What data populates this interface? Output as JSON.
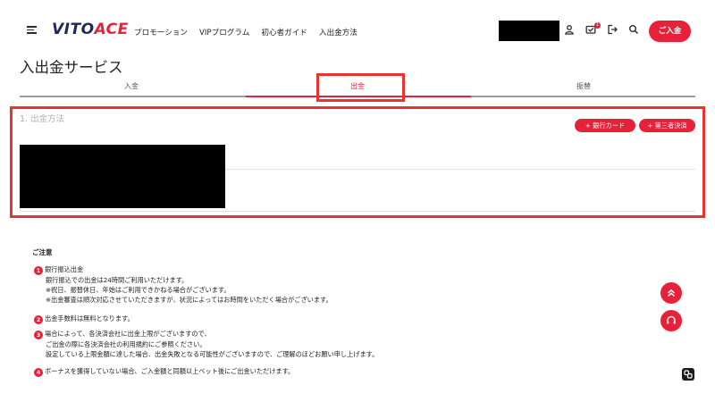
{
  "header": {
    "logo_main": "VITO",
    "logo_accent": "ACE",
    "nav": [
      "プロモーション",
      "VIPプログラム",
      "初心者ガイド",
      "入出金方法"
    ],
    "notification_count": "1",
    "deposit_button": "ご入金"
  },
  "page": {
    "title": "入出金サービス",
    "tabs": [
      "入金",
      "出金",
      "振替"
    ],
    "active_tab": "出金"
  },
  "withdraw": {
    "section_title": "1. 出金方法",
    "add_bank_card": "+ 銀行カード",
    "add_third_party": "+ 第三者決済"
  },
  "notes": {
    "title": "ご注意",
    "items": [
      {
        "num": "1",
        "lines": [
          "銀行振込出金",
          "銀行振込での出金は24時間ご利用いただけます。",
          "※祝日、振替休日、年始はご利用できかねる場合がございます。",
          "※出金審査は順次対応させていただきますが、状況によってはお時間をいただく場合がございます。"
        ]
      },
      {
        "num": "2",
        "lines": [
          "出金手数料は無料となります。"
        ]
      },
      {
        "num": "3",
        "lines": [
          "場合によって、各決済会社に出金上限がございますので、",
          "ご出金の際に各決済会社の利用規約にご参照ください。",
          "設定している上限金額に達した場合、出金失敗となる可能性がございますので、ご理解のほどお願い申し上げます。"
        ]
      },
      {
        "num": "4",
        "lines": [
          "ボーナスを獲得していない場合、ご入金額と同額以上ベット後にご出金いただけます。"
        ]
      }
    ]
  },
  "colors": {
    "accent": "#e8213a",
    "highlight": "#e8342f",
    "logo": "#1c2a5c"
  },
  "icons": [
    "menu-icon",
    "user-icon",
    "inbox-icon",
    "logout-icon",
    "search-icon",
    "chevron-up-icon",
    "headset-icon",
    "link-icon"
  ]
}
